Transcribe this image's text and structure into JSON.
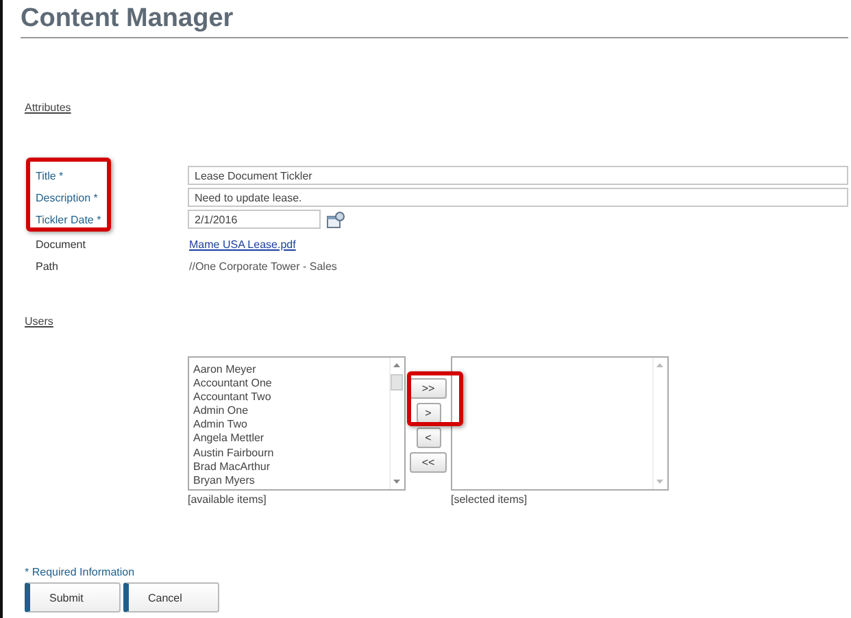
{
  "page": {
    "title": "Content Manager"
  },
  "attributes": {
    "heading": "Attributes",
    "labels_highlighted": true,
    "fields": [
      {
        "kind": "input",
        "label": "Title *",
        "required": true,
        "value": "Lease Document Tickler"
      },
      {
        "kind": "input",
        "label": "Description *",
        "required": true,
        "value": "Need to update lease."
      },
      {
        "kind": "date",
        "label": "Tickler Date *",
        "required": true,
        "value": "2/1/2016"
      },
      {
        "kind": "link",
        "label": "Document",
        "required": false,
        "value": "Mame USA Lease.pdf"
      },
      {
        "kind": "text",
        "label": "Path",
        "required": false,
        "value": "//One Corporate Tower - Sales"
      }
    ]
  },
  "users": {
    "heading": "Users",
    "available": {
      "items": [
        "Aaron Meyer",
        "Accountant One",
        "Accountant Two",
        "Admin One",
        "Admin Two",
        "Angela Mettler",
        "Austin Fairbourn",
        "Brad MacArthur",
        "Bryan Myers"
      ],
      "caption": "[available items]"
    },
    "transfer": {
      "highlighted": true,
      "buttons": [
        ">>",
        ">",
        "<",
        "<<"
      ]
    },
    "selected": {
      "caption": "[selected items]"
    }
  },
  "footer": {
    "note": "* Required Information",
    "buttons": [
      "Submit",
      "Cancel"
    ]
  }
}
